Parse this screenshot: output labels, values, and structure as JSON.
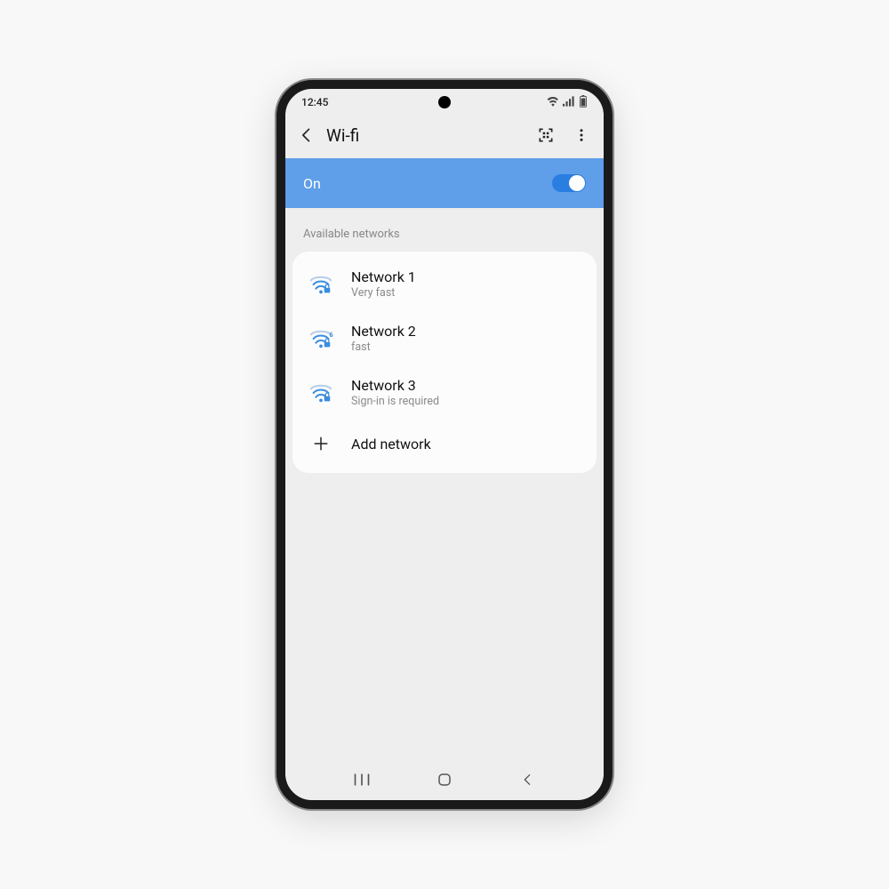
{
  "status": {
    "time": "12:45"
  },
  "header": {
    "title": "Wi-fi"
  },
  "toggle": {
    "label": "On",
    "state": true
  },
  "section": {
    "title": "Available networks"
  },
  "networks": [
    {
      "name": "Network 1",
      "status": "Very fast",
      "secured": true,
      "badge": ""
    },
    {
      "name": "Network 2",
      "status": "fast",
      "secured": true,
      "badge": "6"
    },
    {
      "name": "Network 3",
      "status": "Sign-in is required",
      "secured": true,
      "badge": ""
    }
  ],
  "add": {
    "label": "Add network"
  },
  "colors": {
    "accent": "#5f9ee8",
    "wifi": "#3a8de0"
  }
}
